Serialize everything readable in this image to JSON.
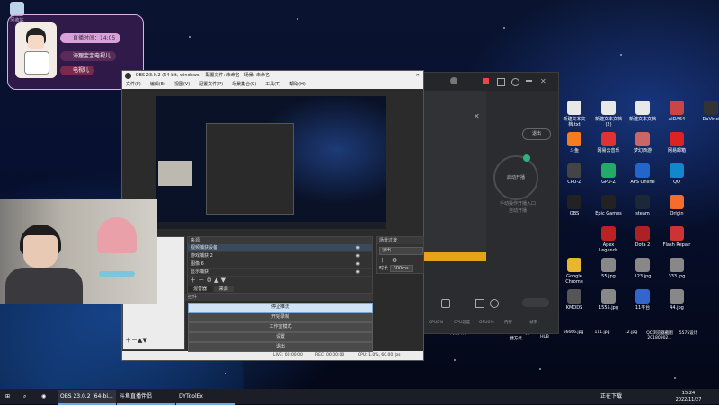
{
  "desktop": {
    "recycle_bin": "回收站",
    "icons": [
      {
        "label": "新建文本文档.txt",
        "col": 0,
        "row": 0,
        "color": "#e8e8e8"
      },
      {
        "label": "新建文本文档 (2)",
        "col": 1,
        "row": 0,
        "color": "#e8e8e8"
      },
      {
        "label": "新建文本文档",
        "col": 2,
        "row": 0,
        "color": "#e8e8e8"
      },
      {
        "label": "AIDA64",
        "col": 3,
        "row": 0,
        "color": "#c44"
      },
      {
        "label": "DaVinci",
        "col": 4,
        "row": 0,
        "color": "#333"
      },
      {
        "label": "斗鱼",
        "col": 0,
        "row": 1,
        "color": "#f57c1f"
      },
      {
        "label": "网易云音乐",
        "col": 1,
        "row": 1,
        "color": "#d33"
      },
      {
        "label": "梦幻西游",
        "col": 2,
        "row": 1,
        "color": "#c66"
      },
      {
        "label": "网易邮箱",
        "col": 3,
        "row": 1,
        "color": "#d22"
      },
      {
        "label": "CPU-Z",
        "col": 0,
        "row": 2,
        "color": "#444"
      },
      {
        "label": "GPU-Z",
        "col": 1,
        "row": 2,
        "color": "#2a6"
      },
      {
        "label": "APS Online",
        "col": 2,
        "row": 2,
        "color": "#26c"
      },
      {
        "label": "QQ",
        "col": 3,
        "row": 2,
        "color": "#18c"
      },
      {
        "label": "OBS",
        "col": 0,
        "row": 3,
        "color": "#222"
      },
      {
        "label": "Epic Games",
        "col": 1,
        "row": 3,
        "color": "#222"
      },
      {
        "label": "steam",
        "col": 2,
        "row": 3,
        "color": "#1b2838"
      },
      {
        "label": "Origin",
        "col": 3,
        "row": 3,
        "color": "#f56c2d"
      },
      {
        "label": "Apex Legends",
        "col": 1,
        "row": 4,
        "color": "#b22"
      },
      {
        "label": "Dota 2",
        "col": 2,
        "row": 4,
        "color": "#a22"
      },
      {
        "label": "Flash Repair",
        "col": 3,
        "row": 4,
        "color": "#c33"
      },
      {
        "label": "Google Chrome",
        "col": 0,
        "row": 5,
        "color": "#e8b730"
      },
      {
        "label": "55.jpg",
        "col": 1,
        "row": 5,
        "color": "#888"
      },
      {
        "label": "123.jpg",
        "col": 2,
        "row": 5,
        "color": "#888"
      },
      {
        "label": "333.jpg",
        "col": 3,
        "row": 5,
        "color": "#888"
      },
      {
        "label": "KMODS",
        "col": 0,
        "row": 6,
        "color": "#555"
      },
      {
        "label": "1555.jpg",
        "col": 1,
        "row": 6,
        "color": "#888"
      },
      {
        "label": "11平台",
        "col": 2,
        "row": 6,
        "color": "#36c"
      },
      {
        "label": "44.jpg",
        "col": 3,
        "row": 6,
        "color": "#888"
      }
    ],
    "bottom_icons": [
      {
        "label": "网易大神"
      },
      {
        "label": "AIDA64"
      },
      {
        "label": "steam.exe 快捷方式"
      },
      {
        "label": "Logitech G HUB"
      },
      {
        "label": "66666.jpg"
      },
      {
        "label": "111.jpg"
      },
      {
        "label": "12.jpg"
      },
      {
        "label": "QQ浏览器截图20180902..."
      },
      {
        "label": "5575设计"
      }
    ]
  },
  "overlay": {
    "live_time": "直播时间：14:05",
    "name1": "海狸宝宝电视儿",
    "name2": "电视儿"
  },
  "obs": {
    "title": "OBS 23.0.2 (64-bit, windows) - 配置文件: 未命名 - 场景: 未命名",
    "menu": [
      "文件(F)",
      "编辑(E)",
      "视图(V)",
      "配置文件(P)",
      "场景集合(S)",
      "工具(T)",
      "帮助(H)"
    ],
    "sources_title": "来源",
    "sources": [
      "视频捕获设备",
      "游戏捕获 2",
      "图像 6",
      "显示捕获"
    ],
    "mixer_title": "场景过渡",
    "transition": "淡出",
    "duration_label": "时长",
    "duration": "300ms",
    "tabs": [
      "混音器",
      "来源"
    ],
    "controls_title": "控件",
    "controls": [
      "停止推流",
      "开始录制",
      "工作室模式",
      "设置",
      "退出"
    ],
    "status": {
      "live": "LIVE: 00:00:00",
      "rec": "REC: 00:00:00",
      "cpu": "CPU: 1.0%, 60.00 fps"
    }
  },
  "app2": {
    "exit_label": "退出",
    "start_label": "启动开播",
    "hint1": "手动操作开播入口",
    "hint2": "自动开播",
    "footer_items": [
      "CPU0%",
      "CPU温度",
      "GPU0%",
      "内存",
      "帧率"
    ]
  },
  "taskbar": {
    "items": [
      "OBS 23.0.2 (64-bi...",
      "斗鱼直播伴侣",
      "DYToolEx"
    ],
    "tray_text": "正在下载",
    "time": "15:24",
    "date": "2022/11/27"
  }
}
